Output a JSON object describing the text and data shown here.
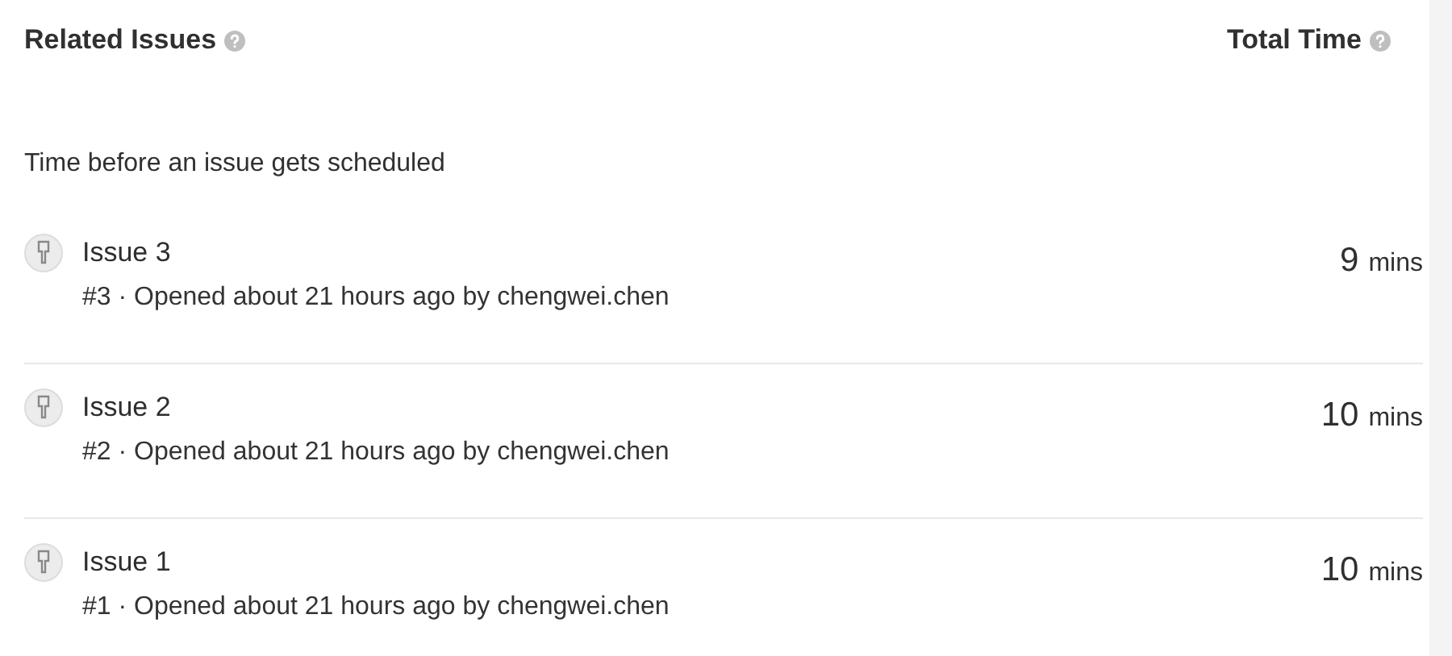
{
  "header": {
    "title": "Related Issues",
    "time_title": "Total Time"
  },
  "description": "Time before an issue gets scheduled",
  "issues": [
    {
      "title": "Issue 3",
      "meta": "#3 · Opened about 21 hours ago by chengwei.chen",
      "time_value": "9",
      "time_unit": "mins"
    },
    {
      "title": "Issue 2",
      "meta": "#2 · Opened about 21 hours ago by chengwei.chen",
      "time_value": "10",
      "time_unit": "mins"
    },
    {
      "title": "Issue 1",
      "meta": "#1 · Opened about 21 hours ago by chengwei.chen",
      "time_value": "10",
      "time_unit": "mins"
    }
  ]
}
